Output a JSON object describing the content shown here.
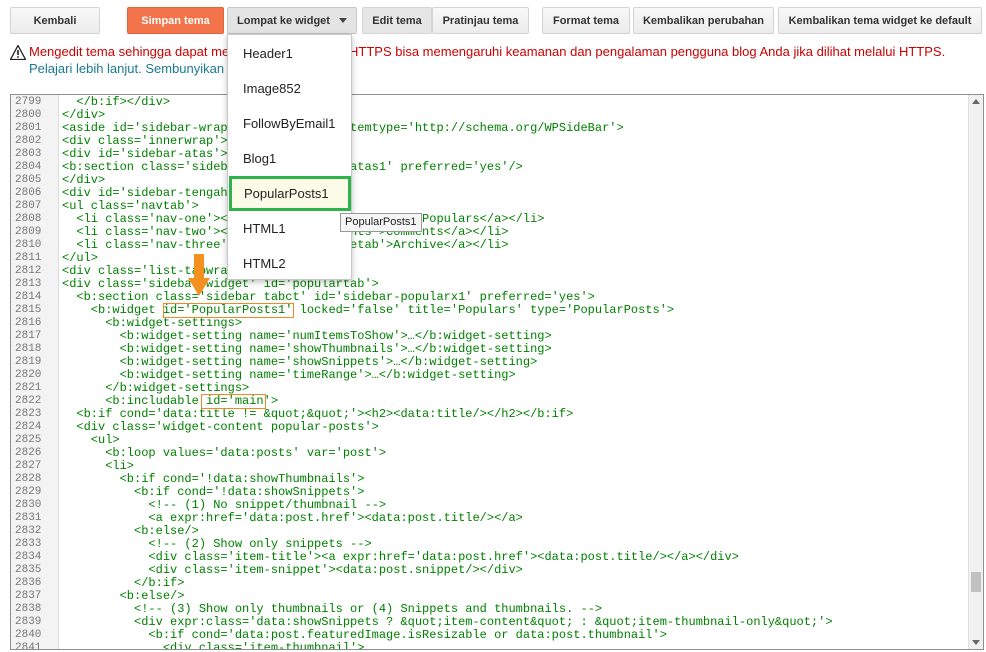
{
  "toolbar": {
    "back": "Kembali",
    "save": "Simpan tema",
    "jump": "Lompat ke widget",
    "edit": "Edit tema",
    "preview": "Pratinjau tema",
    "format": "Format tema",
    "revert": "Kembalikan perubahan",
    "revert_widget": "Kembalikan tema widget ke default"
  },
  "warning": {
    "line1_a": "Mengedit tema sehingga dapat me",
    "line1_b": "HTTPS bisa memengaruhi keamanan dan pengalaman pengguna blog Anda jika dilihat melalui HTTPS.",
    "line2": "Pelajari lebih lanjut. Sembunyikan"
  },
  "colors": {
    "save_button": "#f3744a",
    "selection_border": "#2db34a",
    "highlight": "#f08a24",
    "warning_text": "#cc0000",
    "link_text": "#1a7a92"
  },
  "widget_menu": [
    "Header1",
    "Image852",
    "FollowByEmail1",
    "Blog1",
    "PopularPosts1",
    "HTML1",
    "HTML2"
  ],
  "widget_menu_selected": "PopularPosts1",
  "tooltip": "PopularPosts1",
  "code_lines": [
    {
      "n": "2799",
      "t": "  </b:if></div>"
    },
    {
      "n": "2800",
      "t": "</div>"
    },
    {
      "n": "2801",
      "t": "<aside id='sidebar-wrap                itemtype='http://schema.org/WPSideBar'>"
    },
    {
      "n": "2802",
      "t": "<div class='innerwrap'>"
    },
    {
      "n": "2803",
      "t": "<div id='sidebar-atas'>"
    },
    {
      "n": "2804",
      "t": "<b:section class='sideb                 atas1' preferred='yes'/>"
    },
    {
      "n": "2805",
      "t": "</div>"
    },
    {
      "n": "2806",
      "t": "<div id='sidebar-tengah"
    },
    {
      "n": "2807",
      "t": "<ul class='navtab'>"
    },
    {
      "n": "2808",
      "t": "  <li class='nav-one'><                 pulartab'>Populars</a></li>"
    },
    {
      "n": "2809",
      "t": "  <li class='nav-two'><                 nts'>Comments</a></li>"
    },
    {
      "n": "2810",
      "t": "  <li class='nav-three'                 etab'>Archive</a></li>"
    },
    {
      "n": "2811",
      "t": "</ul>"
    },
    {
      "n": "2812",
      "t": "<div class='list-tabwrap"
    },
    {
      "n": "2813",
      "t": "<div class='sidebar-widget' id='populartab'>"
    },
    {
      "n": "2814",
      "t": "  <b:section class='sidebar tabct' id='sidebar-popularx1' preferred='yes'>"
    },
    {
      "n": "2815",
      "t": "    <b:widget id='PopularPosts1' locked='false' title='Populars' type='PopularPosts'>"
    },
    {
      "n": "2816",
      "t": "      <b:widget-settings>"
    },
    {
      "n": "2817",
      "t": "        <b:widget-setting name='numItemsToShow'>…</b:widget-setting>"
    },
    {
      "n": "2818",
      "t": "        <b:widget-setting name='showThumbnails'>…</b:widget-setting>"
    },
    {
      "n": "2819",
      "t": "        <b:widget-setting name='showSnippets'>…</b:widget-setting>"
    },
    {
      "n": "2820",
      "t": "        <b:widget-setting name='timeRange'>…</b:widget-setting>"
    },
    {
      "n": "2821",
      "t": "      </b:widget-settings>"
    },
    {
      "n": "2822",
      "t": "      <b:includable id='main'>"
    },
    {
      "n": "2823",
      "t": "  <b:if cond='data:title != &quot;&quot;'><h2><data:title/></h2></b:if>"
    },
    {
      "n": "2824",
      "t": "  <div class='widget-content popular-posts'>"
    },
    {
      "n": "2825",
      "t": "    <ul>"
    },
    {
      "n": "2826",
      "t": "      <b:loop values='data:posts' var='post'>"
    },
    {
      "n": "2827",
      "t": "      <li>"
    },
    {
      "n": "2828",
      "t": "        <b:if cond='!data:showThumbnails'>"
    },
    {
      "n": "2829",
      "t": "          <b:if cond='!data:showSnippets'>"
    },
    {
      "n": "2830",
      "t": "            <!-- (1) No snippet/thumbnail -->"
    },
    {
      "n": "2831",
      "t": "            <a expr:href='data:post.href'><data:post.title/></a>"
    },
    {
      "n": "2832",
      "t": "          <b:else/>"
    },
    {
      "n": "2833",
      "t": "            <!-- (2) Show only snippets -->"
    },
    {
      "n": "2834",
      "t": "            <div class='item-title'><a expr:href='data:post.href'><data:post.title/></a></div>"
    },
    {
      "n": "2835",
      "t": "            <div class='item-snippet'><data:post.snippet/></div>"
    },
    {
      "n": "2836",
      "t": "          </b:if>"
    },
    {
      "n": "2837",
      "t": "        <b:else/>"
    },
    {
      "n": "2838",
      "t": "          <!-- (3) Show only thumbnails or (4) Snippets and thumbnails. -->"
    },
    {
      "n": "2839",
      "t": "          <div expr:class='data:showSnippets ? &quot;item-content&quot; : &quot;item-thumbnail-only&quot;'>"
    },
    {
      "n": "2840",
      "t": "            <b:if cond='data:post.featuredImage.isResizable or data:post.thumbnail'>"
    },
    {
      "n": "2841",
      "t": "              <div class='item-thumbnail'>"
    }
  ]
}
